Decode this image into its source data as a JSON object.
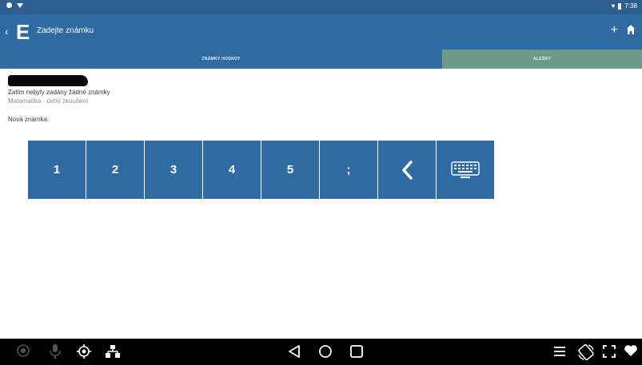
{
  "status_bar": {
    "time": "7:38"
  },
  "app_bar": {
    "logo": "E",
    "title": "Zadejte známku",
    "plus": "+"
  },
  "tabs": [
    {
      "label": "ZNÁMKY HODNOT"
    },
    {
      "label": "ALEŠKY"
    }
  ],
  "content": {
    "message": "Zatím nebyly zadány žádné známky",
    "subject": "Matematika · ústní zkoušení",
    "new_grade_label": "Nová známka:"
  },
  "keypad": {
    "keys": [
      "1",
      "2",
      "3",
      "4",
      "5",
      ";"
    ],
    "backspace": "<"
  },
  "icons": {
    "keyboard": "keyboard-icon",
    "home": "home-icon"
  },
  "colors": {
    "primary": "#2f6aa3",
    "status": "#2f5f91",
    "tab_secondary": "#6c9b8c",
    "navbar": "#000000"
  }
}
